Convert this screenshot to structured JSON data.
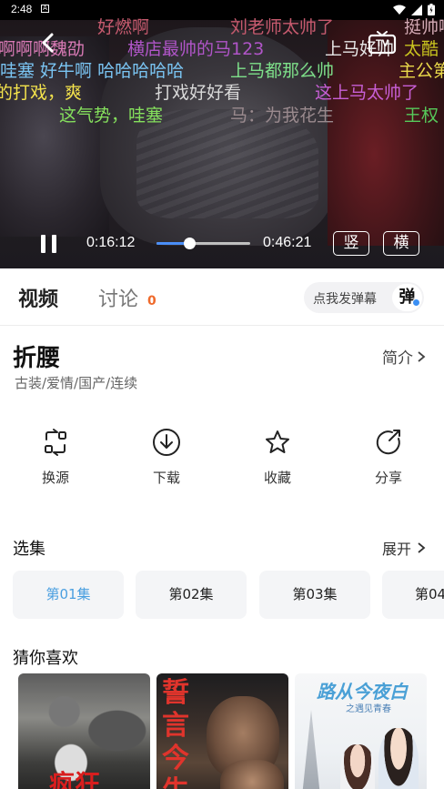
{
  "statusbar": {
    "time": "2:48",
    "notif_glyph": "A"
  },
  "player": {
    "tv_label": "TV",
    "current_time": "0:16:12",
    "total_time": "0:46:21",
    "progress": 0.35,
    "portrait_label": "竖",
    "landscape_label": "横",
    "danmaku": [
      {
        "text": "好燃啊",
        "color": "#c65a6e"
      },
      {
        "text": "刘老师太帅了",
        "color": "#c65a6e"
      },
      {
        "text": "挺帅啊",
        "color": "#d3a9b4"
      },
      {
        "text": "啊啊啊魏劭",
        "color": "#d97ab5"
      },
      {
        "text": "横店最帅的马123",
        "color": "#b055c8"
      },
      {
        "text": "上马好帅",
        "color": "#e6e6e6"
      },
      {
        "text": "太酷",
        "color": "#c9c41f"
      },
      {
        "text": "哇塞 好牛啊 哈哈哈哈哈",
        "color": "#7ac4f2"
      },
      {
        "text": "上马都那么帅",
        "color": "#7ee08a"
      },
      {
        "text": "主公第",
        "color": "#ead94a"
      },
      {
        "text": "的打戏，爽",
        "color": "#f4e34c"
      },
      {
        "text": "打戏好好看",
        "color": "#d9d9d9"
      },
      {
        "text": "这上马太帅了",
        "color": "#c85fd6"
      },
      {
        "text": "这气势，哇塞",
        "color": "#85e05d"
      },
      {
        "text": "马：为我花生",
        "color": "#9a8a8e"
      },
      {
        "text": "王权",
        "color": "#56c95a"
      }
    ]
  },
  "tabs": {
    "video": "视频",
    "discuss": "讨论",
    "discuss_count": "0",
    "danmaku_hint": "点我发弹幕",
    "danmaku_button": "弹"
  },
  "show": {
    "title": "折腰",
    "tags": "古装/爱情/国产/连续",
    "intro_label": "简介"
  },
  "actions": [
    {
      "label": "换源",
      "icon": "switch-source-icon"
    },
    {
      "label": "下载",
      "icon": "download-icon"
    },
    {
      "label": "收藏",
      "icon": "star-icon"
    },
    {
      "label": "分享",
      "icon": "share-icon"
    }
  ],
  "episodes": {
    "heading": "选集",
    "expand_label": "展开",
    "items": [
      "第01集",
      "第02集",
      "第03集",
      "第04"
    ],
    "active_index": 0,
    "active_color": "#4a9fe0"
  },
  "recommend": {
    "heading": "猜你喜欢",
    "posters": [
      {
        "title_art": "疯狂"
      },
      {
        "title_art": "誓言今生"
      },
      {
        "title_art": "路从今夜白",
        "subtitle_art": "之遇见青春"
      }
    ]
  },
  "colors": {
    "accent": "#4a8ef7",
    "count": "#ef6a2c",
    "danmaku_dot": "#3b8ff3"
  }
}
